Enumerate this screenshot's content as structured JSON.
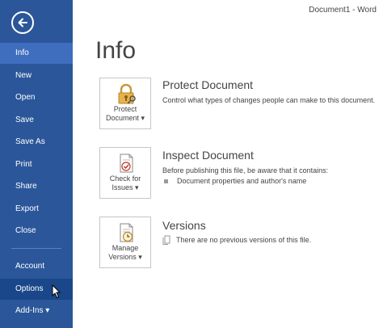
{
  "window": {
    "title": "Document1 - Word"
  },
  "sidebar": {
    "items": [
      {
        "label": "Info",
        "state": "selected"
      },
      {
        "label": "New"
      },
      {
        "label": "Open"
      },
      {
        "label": "Save"
      },
      {
        "label": "Save As"
      },
      {
        "label": "Print"
      },
      {
        "label": "Share"
      },
      {
        "label": "Export"
      },
      {
        "label": "Close"
      },
      {
        "label": "Account"
      },
      {
        "label": "Options",
        "state": "hover"
      },
      {
        "label": "Add-Ins ▾"
      }
    ]
  },
  "main": {
    "title": "Info",
    "sections": [
      {
        "tile_label_1": "Protect",
        "tile_label_2": "Document ▾",
        "title": "Protect Document",
        "description": "Control what types of changes people can make to this document."
      },
      {
        "tile_label_1": "Check for",
        "tile_label_2": "Issues ▾",
        "title": "Inspect Document",
        "description": "Before publishing this file, be aware that it contains:",
        "bullet": "Document properties and author's name"
      },
      {
        "tile_label_1": "Manage",
        "tile_label_2": "Versions ▾",
        "title": "Versions",
        "note": "There are no previous versions of this file."
      }
    ]
  },
  "colors": {
    "sidebar": "#2b579a",
    "sidebar_selected": "#3f6ebf",
    "sidebar_hover": "#19478a",
    "text": "#444444"
  },
  "icons": [
    "back-arrow-icon",
    "lock-key-icon",
    "document-check-icon",
    "document-clock-icon",
    "bullet-square-icon",
    "version-page-icon",
    "mouse-cursor-icon"
  ]
}
